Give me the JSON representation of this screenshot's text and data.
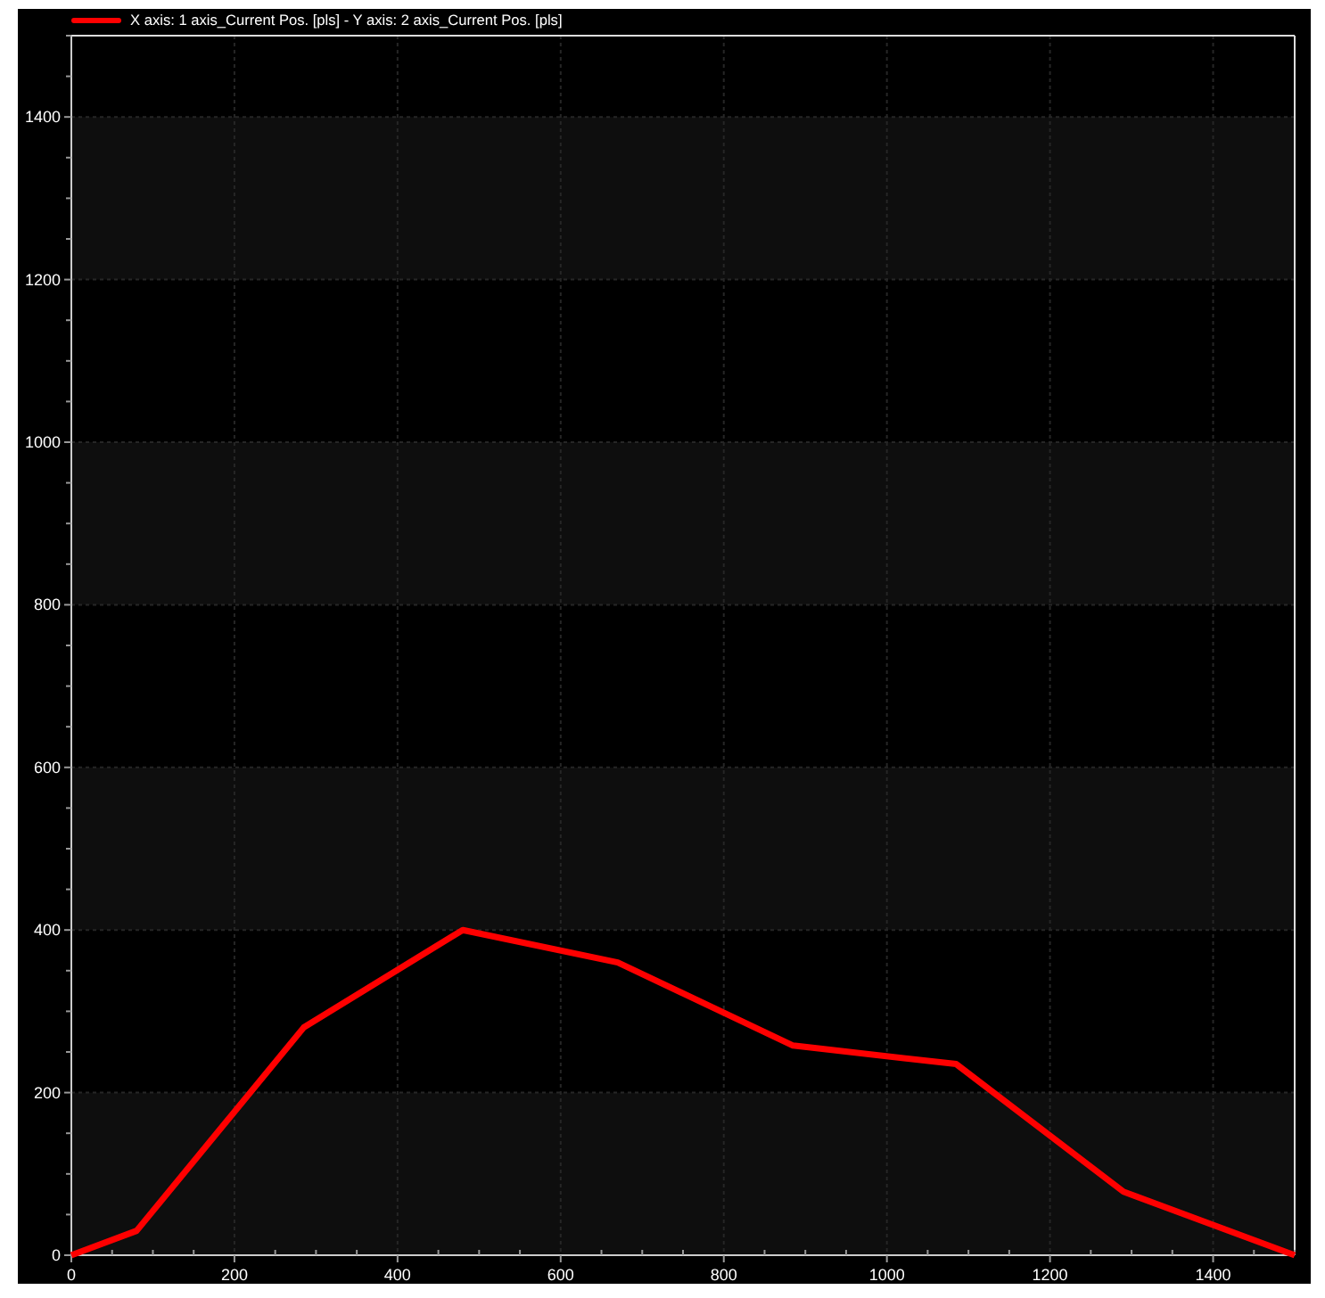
{
  "chart_data": {
    "type": "line",
    "grid": true,
    "x": [
      0,
      80,
      285,
      480,
      670,
      885,
      1085,
      1290,
      1500
    ],
    "series": [
      {
        "name": "X axis: 1 axis_Current Pos. [pls] - Y axis: 2 axis_Current Pos. [pls]",
        "color": "#ff0000",
        "values": [
          0,
          30,
          280,
          400,
          360,
          258,
          235,
          78,
          0
        ]
      }
    ],
    "xlim": [
      0,
      1500
    ],
    "ylim": [
      0,
      1500
    ],
    "xticks": [
      0,
      200,
      400,
      600,
      800,
      1000,
      1200,
      1400
    ],
    "yticks": [
      0,
      200,
      400,
      600,
      800,
      1000,
      1200,
      1400
    ]
  }
}
